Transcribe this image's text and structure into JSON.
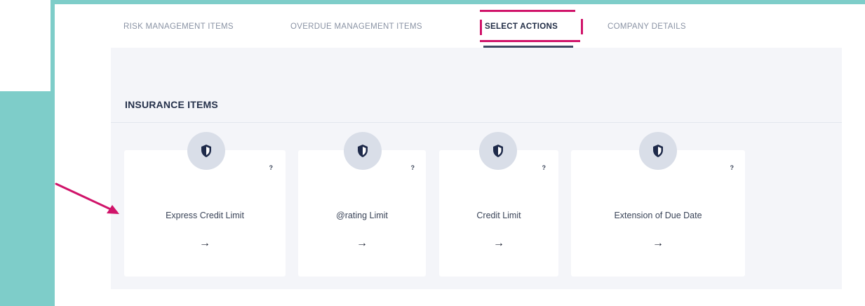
{
  "tabs": [
    {
      "label": "RISK MANAGEMENT ITEMS",
      "active": false
    },
    {
      "label": "OVERDUE MANAGEMENT ITEMS",
      "active": false
    },
    {
      "label": "SELECT ACTIONS",
      "active": true
    },
    {
      "label": "COMPANY DETAILS",
      "active": false
    }
  ],
  "section": {
    "title": "INSURANCE ITEMS"
  },
  "cards": [
    {
      "title": "Express Credit Limit",
      "help": "?",
      "arrow": "→",
      "icon": "shield-icon"
    },
    {
      "title": "@rating Limit",
      "help": "?",
      "arrow": "→",
      "icon": "shield-icon"
    },
    {
      "title": "Credit Limit",
      "help": "?",
      "arrow": "→",
      "icon": "shield-icon"
    },
    {
      "title": "Extension of Due Date",
      "help": "?",
      "arrow": "→",
      "icon": "shield-icon"
    }
  ],
  "colors": {
    "accent_frame": "#7ecdc9",
    "highlight": "#d0146a",
    "active_tab_underline": "#3d4a63",
    "panel_bg": "#f4f5f9"
  }
}
